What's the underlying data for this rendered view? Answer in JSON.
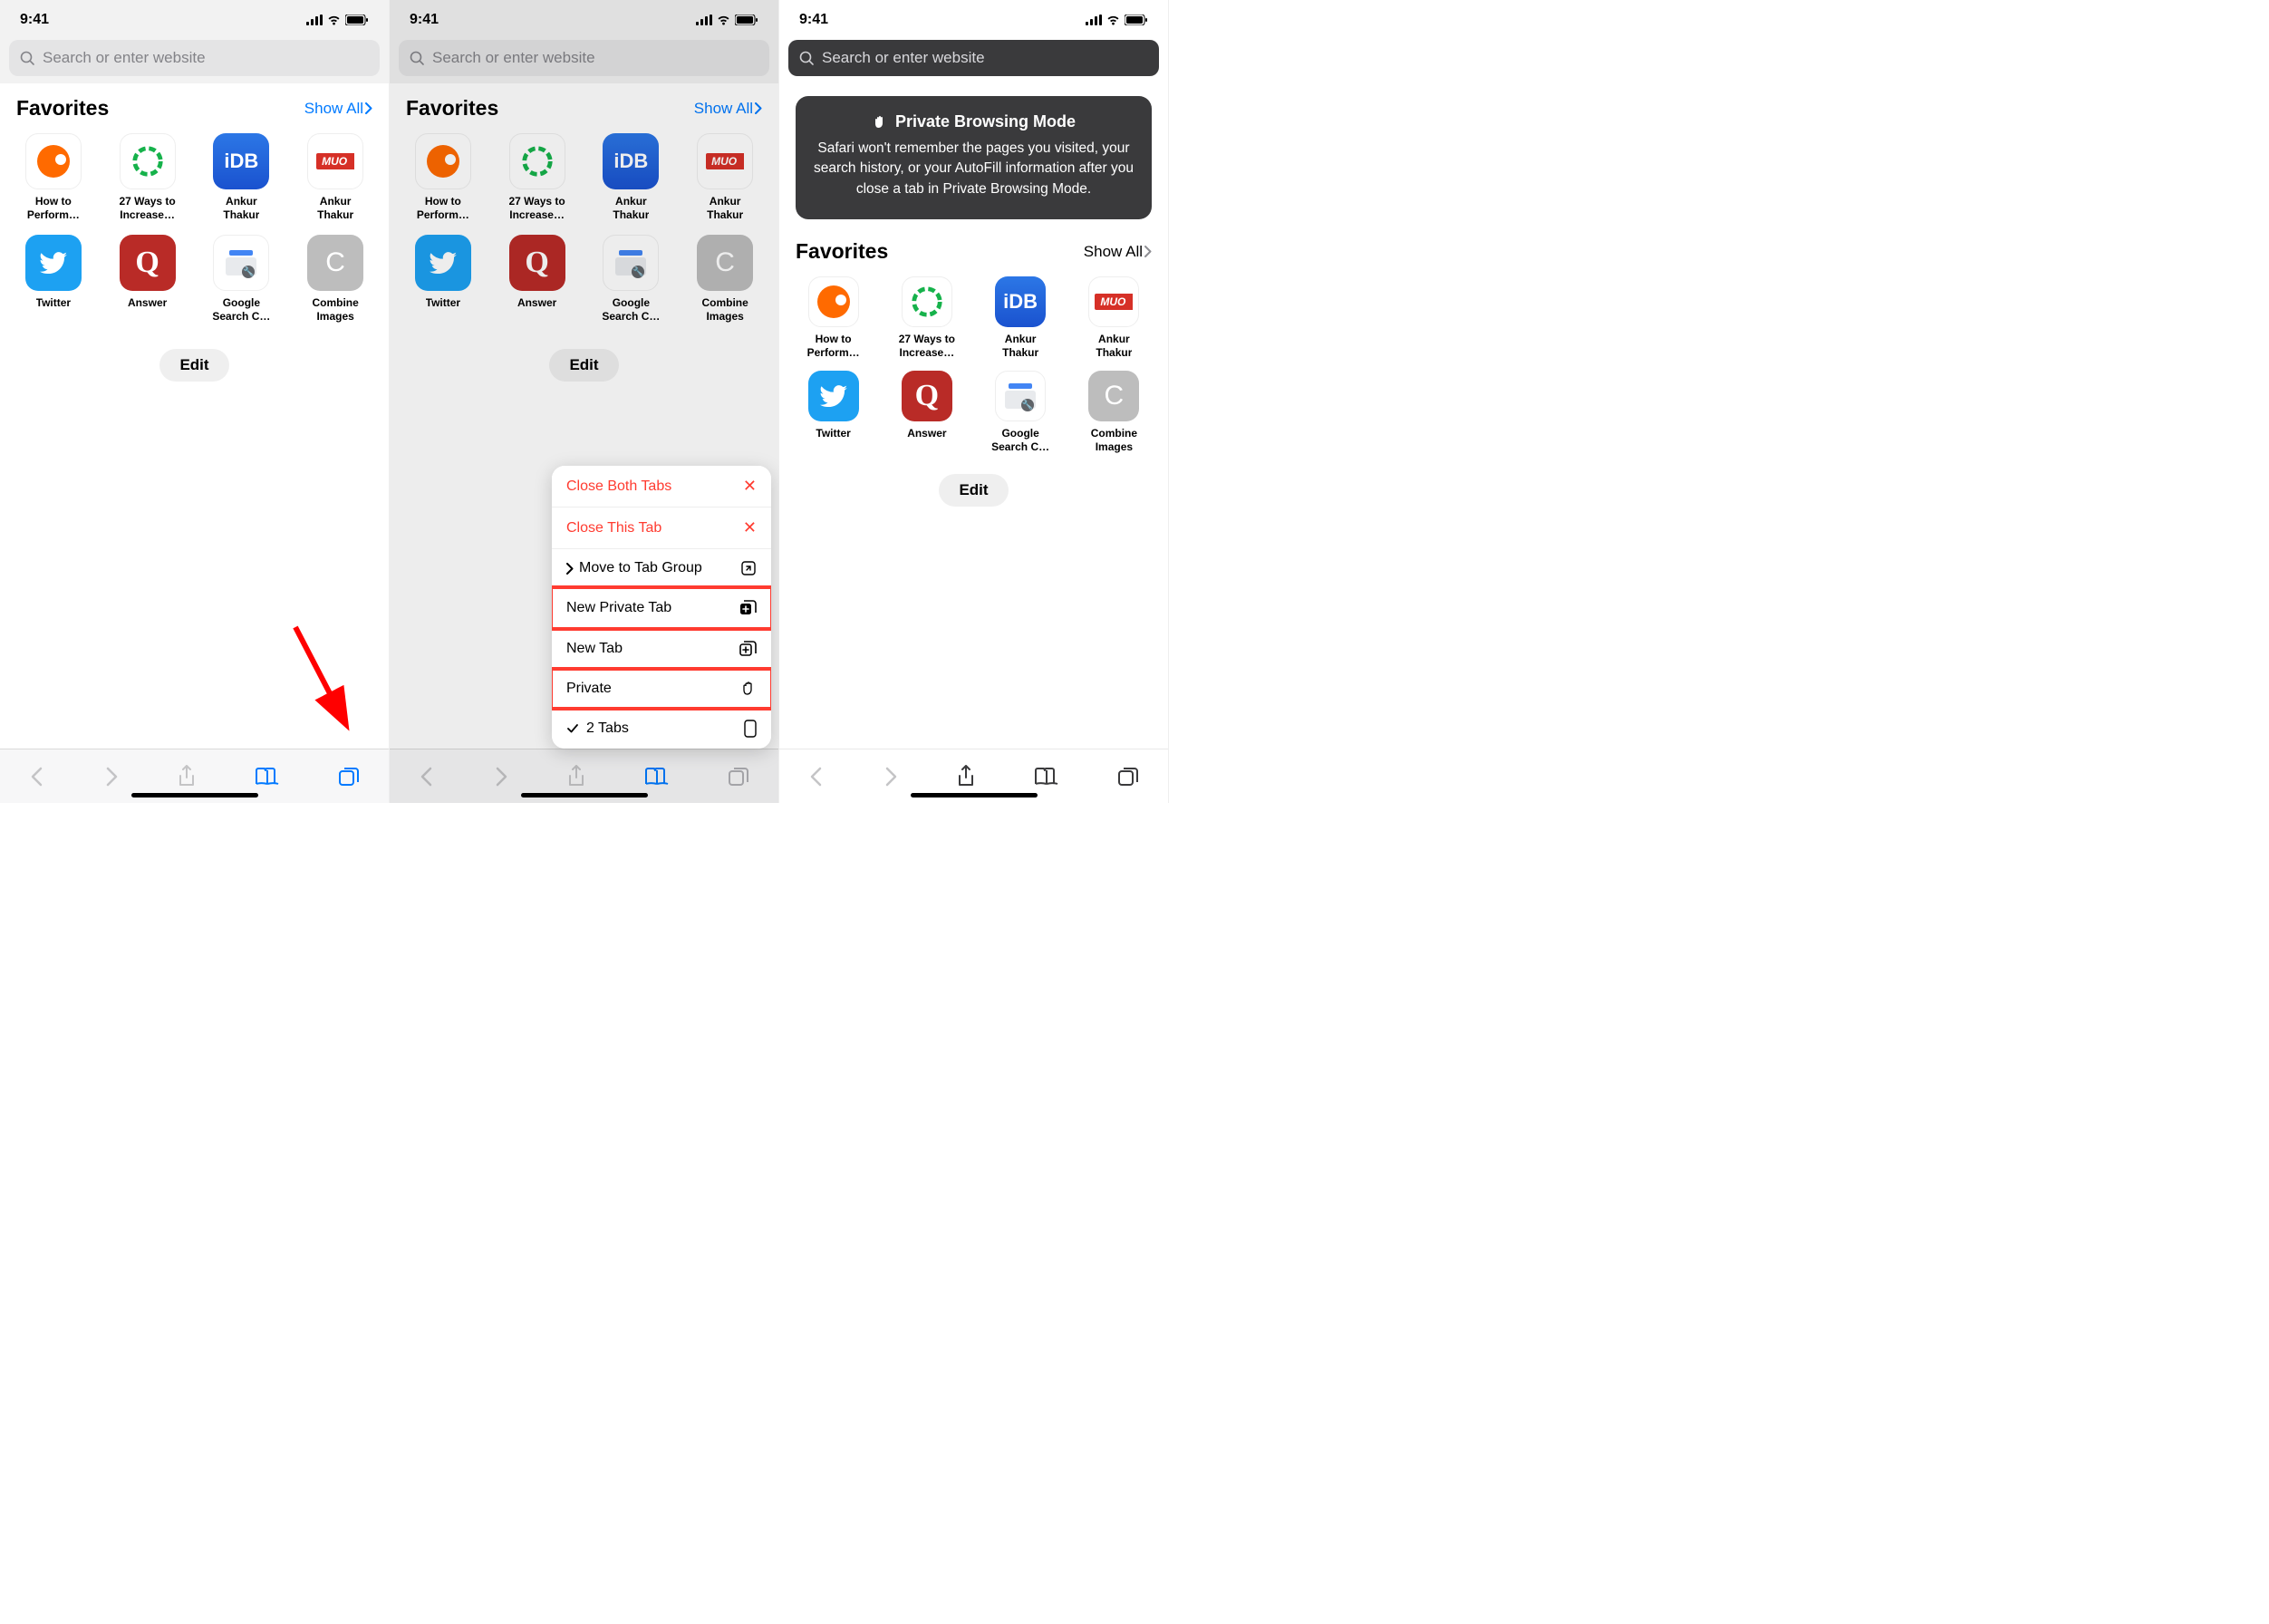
{
  "status": {
    "time": "9:41"
  },
  "search": {
    "placeholder": "Search or enter website"
  },
  "favorites": {
    "title": "Favorites",
    "show_all": "Show All",
    "edit": "Edit",
    "items": [
      {
        "label": "How to\nPerform…",
        "name": "semrush"
      },
      {
        "label": "27 Ways to\nIncrease…",
        "name": "neilpatel"
      },
      {
        "label": "Ankur\nThakur",
        "name": "idb"
      },
      {
        "label": "Ankur\nThakur",
        "name": "muo"
      },
      {
        "label": "Twitter",
        "name": "twitter"
      },
      {
        "label": "Answer",
        "name": "quora"
      },
      {
        "label": "Google\nSearch C…",
        "name": "google-search-console"
      },
      {
        "label": "Combine\nImages",
        "name": "combine-images"
      }
    ]
  },
  "menu": {
    "close_both": "Close Both Tabs",
    "close_this": "Close This Tab",
    "move_group": "Move to Tab Group",
    "new_private": "New Private Tab",
    "new_tab": "New Tab",
    "private": "Private",
    "two_tabs": "2 Tabs"
  },
  "private_mode": {
    "title": "Private Browsing Mode",
    "text": "Safari won't remember the pages you visited, your search history, or your AutoFill information after you close a tab in Private Browsing Mode."
  }
}
